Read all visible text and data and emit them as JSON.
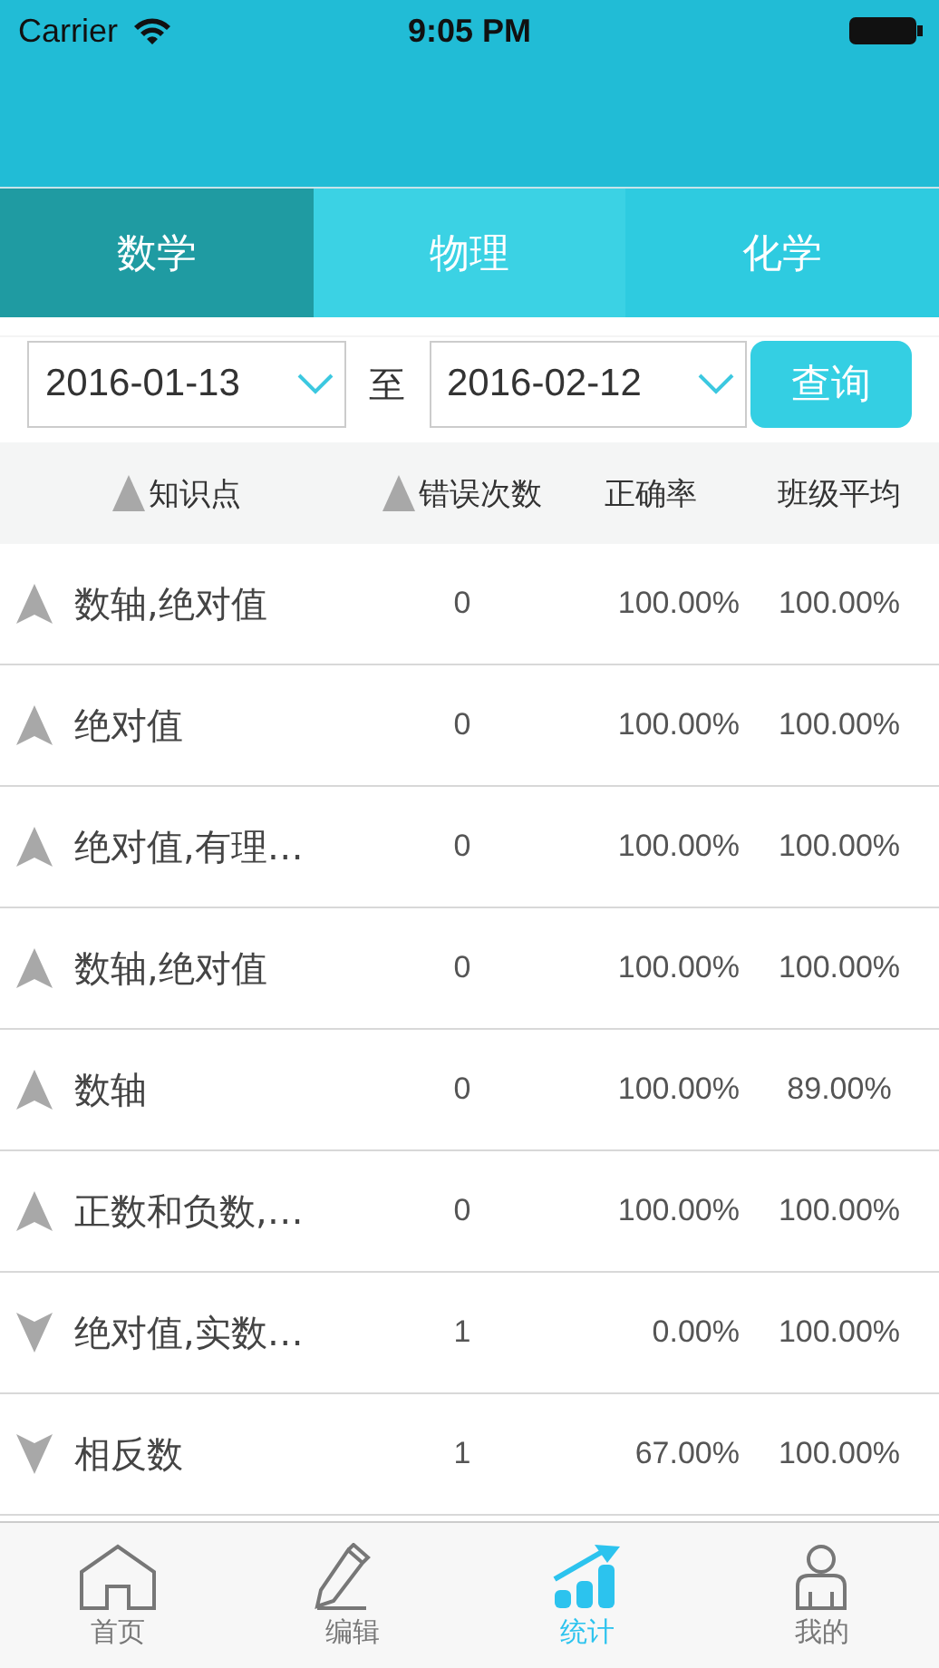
{
  "status_bar": {
    "carrier": "Carrier",
    "time": "9:05 PM"
  },
  "subject_tabs": [
    {
      "label": "数学",
      "selected": true
    },
    {
      "label": "物理",
      "selected": false
    },
    {
      "label": "化学",
      "selected": false
    }
  ],
  "date_filter": {
    "start": "2016-01-13",
    "separator": "至",
    "end": "2016-02-12",
    "button": "查询"
  },
  "table": {
    "columns": [
      {
        "label": "知识点",
        "sortable": true
      },
      {
        "label": "错误次数",
        "sortable": true
      },
      {
        "label": "正确率",
        "sortable": false
      },
      {
        "label": "班级平均",
        "sortable": false
      }
    ],
    "rows": [
      {
        "kind": "up",
        "topic": "数轴,绝对值",
        "errors": "0",
        "accuracy": "100.00%",
        "class_average": "100.00%"
      },
      {
        "kind": "up",
        "topic": "绝对值",
        "errors": "0",
        "accuracy": "100.00%",
        "class_average": "100.00%"
      },
      {
        "kind": "up",
        "topic": "绝对值,有理…",
        "errors": "0",
        "accuracy": "100.00%",
        "class_average": "100.00%"
      },
      {
        "kind": "up",
        "topic": "数轴,绝对值",
        "errors": "0",
        "accuracy": "100.00%",
        "class_average": "100.00%"
      },
      {
        "kind": "up",
        "topic": "数轴",
        "errors": "0",
        "accuracy": "100.00%",
        "class_average": "89.00%"
      },
      {
        "kind": "up",
        "topic": "正数和负数,…",
        "errors": "0",
        "accuracy": "100.00%",
        "class_average": "100.00%"
      },
      {
        "kind": "down",
        "topic": "绝对值,实数…",
        "errors": "1",
        "accuracy": "0.00%",
        "class_average": "100.00%"
      },
      {
        "kind": "down",
        "topic": "相反数",
        "errors": "1",
        "accuracy": "67.00%",
        "class_average": "100.00%"
      }
    ]
  },
  "tab_bar": [
    {
      "label": "首页",
      "kind": "home",
      "selected": false
    },
    {
      "label": "编辑",
      "kind": "pencil",
      "selected": false
    },
    {
      "label": "统计",
      "kind": "chart",
      "selected": true
    },
    {
      "label": "我的",
      "kind": "person",
      "selected": false
    }
  ]
}
